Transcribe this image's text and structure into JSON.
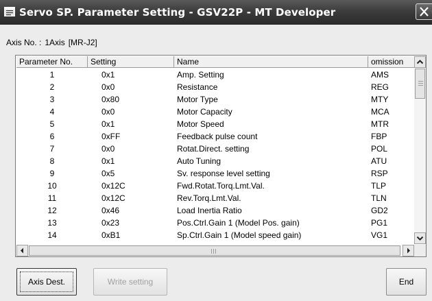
{
  "window": {
    "title": "Servo SP. Parameter Setting - GSV22P - MT Developer",
    "close_glyph": "X"
  },
  "axis_info": {
    "prefix": "Axis No. :",
    "axis": "1Axis",
    "model": "[MR-J2]"
  },
  "table": {
    "columns": [
      "Parameter No.",
      "Setting",
      "Name",
      "omission"
    ],
    "rows": [
      {
        "no": "1",
        "setting": "0x1",
        "name": "Amp. Setting",
        "omission": "AMS"
      },
      {
        "no": "2",
        "setting": "0x0",
        "name": "Resistance",
        "omission": "REG"
      },
      {
        "no": "3",
        "setting": "0x80",
        "name": "Motor Type",
        "omission": "MTY"
      },
      {
        "no": "4",
        "setting": "0x0",
        "name": "Motor Capacity",
        "omission": "MCA"
      },
      {
        "no": "5",
        "setting": "0x1",
        "name": "Motor Speed",
        "omission": "MTR"
      },
      {
        "no": "6",
        "setting": "0xFF",
        "name": "Feedback pulse count",
        "omission": "FBP"
      },
      {
        "no": "7",
        "setting": "0x0",
        "name": "Rotat.Direct. setting",
        "omission": "POL"
      },
      {
        "no": "8",
        "setting": "0x1",
        "name": "Auto Tuning",
        "omission": "ATU"
      },
      {
        "no": "9",
        "setting": "0x5",
        "name": "Sv. response level setting",
        "omission": "RSP"
      },
      {
        "no": "10",
        "setting": "0x12C",
        "name": "Fwd.Rotat.Torq.Lmt.Val.",
        "omission": "TLP"
      },
      {
        "no": "11",
        "setting": "0x12C",
        "name": "Rev.Torq.Lmt.Val.",
        "omission": "TLN"
      },
      {
        "no": "12",
        "setting": "0x46",
        "name": "Load Inertia Ratio",
        "omission": "GD2"
      },
      {
        "no": "13",
        "setting": "0x23",
        "name": "Pos.Ctrl.Gain 1 (Model Pos. gain)",
        "omission": "PG1"
      },
      {
        "no": "14",
        "setting": "0xB1",
        "name": "Sp.Ctrl.Gain 1 (Model speed gain)",
        "omission": "VG1"
      }
    ]
  },
  "buttons": {
    "axis_dest": "Axis Dest.",
    "write_setting": "Write setting",
    "end": "End"
  },
  "colors": {
    "titlebar": "#3c3c3c",
    "window_bg": "#ececec",
    "disabled_text": "#a0a0a0"
  }
}
